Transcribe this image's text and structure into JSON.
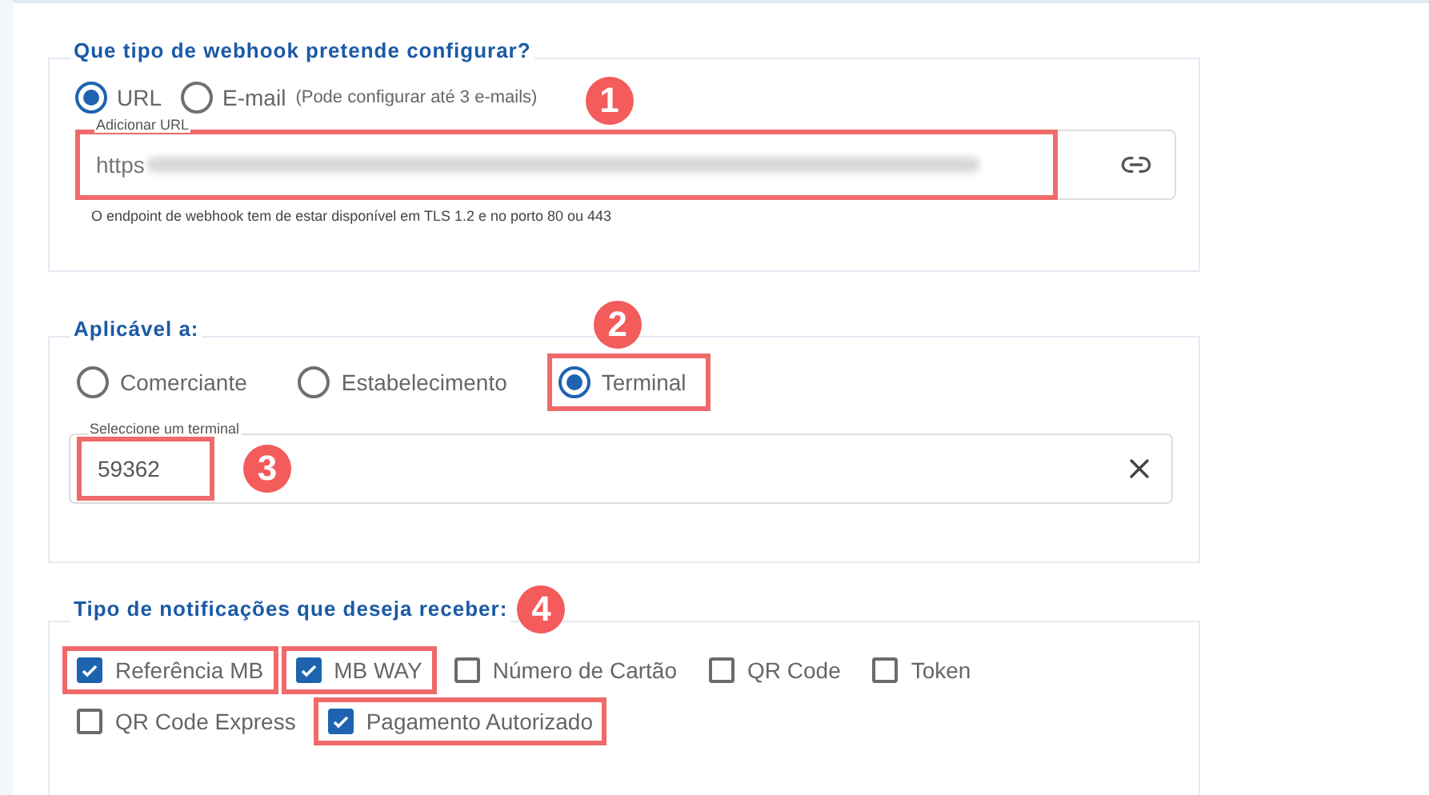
{
  "webhook_type": {
    "legend": "Que tipo de webhook pretende configurar?",
    "marker": "1",
    "options": [
      {
        "label": "URL",
        "selected": true
      },
      {
        "label": "E-mail",
        "selected": false,
        "hint": "(Pode configurar até 3 e-mails)"
      }
    ],
    "url_field": {
      "label": "Adicionar URL",
      "value": "https",
      "redacted": true,
      "highlighted": true
    },
    "help": "O endpoint de webhook tem de estar disponível em TLS 1.2 e no porto 80 ou 443"
  },
  "applies_to": {
    "legend": "Aplicável a:",
    "options": [
      {
        "label": "Comerciante",
        "selected": false,
        "highlighted": false
      },
      {
        "label": "Estabelecimento",
        "selected": false,
        "highlighted": false
      },
      {
        "label": "Terminal",
        "selected": true,
        "highlighted": true,
        "marker": "2"
      }
    ],
    "terminal_field": {
      "label": "Seleccione um terminal",
      "value": "59362",
      "highlighted": true,
      "marker": "3"
    }
  },
  "notifications": {
    "legend": "Tipo de notificações que deseja receber:",
    "marker": "4",
    "rows": [
      [
        {
          "label": "Referência MB",
          "checked": true,
          "highlighted": true
        },
        {
          "label": "MB WAY",
          "checked": true,
          "highlighted": true
        },
        {
          "label": "Número de Cartão",
          "checked": false,
          "highlighted": false
        },
        {
          "label": "QR Code",
          "checked": false,
          "highlighted": false
        },
        {
          "label": "Token",
          "checked": false,
          "highlighted": false
        }
      ],
      [
        {
          "label": "QR Code Express",
          "checked": false,
          "highlighted": false
        },
        {
          "label": "Pagamento Autorizado",
          "checked": true,
          "highlighted": true
        }
      ]
    ]
  }
}
